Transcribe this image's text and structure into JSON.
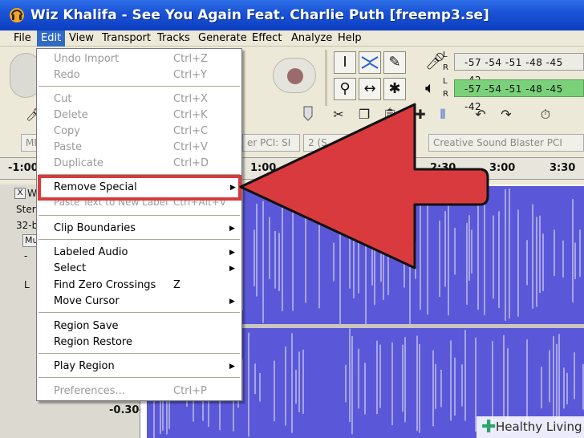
{
  "window": {
    "title": "Wiz Khalifa - See You Again Feat. Charlie Puth [freemp3.se]"
  },
  "menubar": {
    "items": [
      "File",
      "Edit",
      "View",
      "Transport",
      "Tracks",
      "Generate",
      "Effect",
      "Analyze",
      "Help"
    ],
    "active": "Edit"
  },
  "edit_menu": {
    "items": [
      {
        "label": "Undo Import",
        "shortcut": "Ctrl+Z",
        "disabled": true
      },
      {
        "label": "Redo",
        "shortcut": "Ctrl+Y",
        "disabled": true
      },
      {
        "label": "Cut",
        "shortcut": "Ctrl+X",
        "disabled": true
      },
      {
        "label": "Delete",
        "shortcut": "Ctrl+K",
        "disabled": true
      },
      {
        "label": "Copy",
        "shortcut": "Ctrl+C",
        "disabled": true
      },
      {
        "label": "Paste",
        "shortcut": "Ctrl+V",
        "disabled": true
      },
      {
        "label": "Duplicate",
        "shortcut": "Ctrl+D",
        "disabled": true
      },
      {
        "label": "Remove Special",
        "submenu": true,
        "highlighted": true
      },
      {
        "label": "Paste Text to New Label",
        "shortcut": "Ctrl+Alt+V",
        "disabled": true
      },
      {
        "label": "Clip Boundaries",
        "submenu": true
      },
      {
        "label": "Labeled Audio",
        "submenu": true
      },
      {
        "label": "Select",
        "submenu": true
      },
      {
        "label": "Find Zero Crossings",
        "shortcut": "Z"
      },
      {
        "label": "Move Cursor",
        "submenu": true
      },
      {
        "label": "Region Save"
      },
      {
        "label": "Region Restore"
      },
      {
        "label": "Play Region",
        "submenu": true
      },
      {
        "label": "Preferences...",
        "shortcut": "Ctrl+P",
        "disabled": true
      }
    ]
  },
  "meters": {
    "record_scale": "-57 -54 -51 -48 -45 -42",
    "play_scale": "-57 -54 -51 -48 -45 -42",
    "left": "L",
    "right": "R"
  },
  "devices": {
    "host": "MM",
    "input": "er PCI: SI",
    "channels": "2 (S",
    "output": "Creative Sound Blaster PCI"
  },
  "ruler": {
    "labels": [
      "-1:00",
      "1:00",
      "2:30",
      "3:00",
      "3:30"
    ]
  },
  "track": {
    "close": "X",
    "name": "W",
    "info1": "Ster",
    "info2": "32-b",
    "mute": "Mu",
    "pan": "L",
    "minus": "-",
    "scale_bottom": "-0.30-"
  },
  "watermark": {
    "brand": "Healthy Living"
  },
  "colors": {
    "waveform": "#5a58d8",
    "callout": "#d83a3e",
    "menu_highlight": "#316ac5"
  }
}
